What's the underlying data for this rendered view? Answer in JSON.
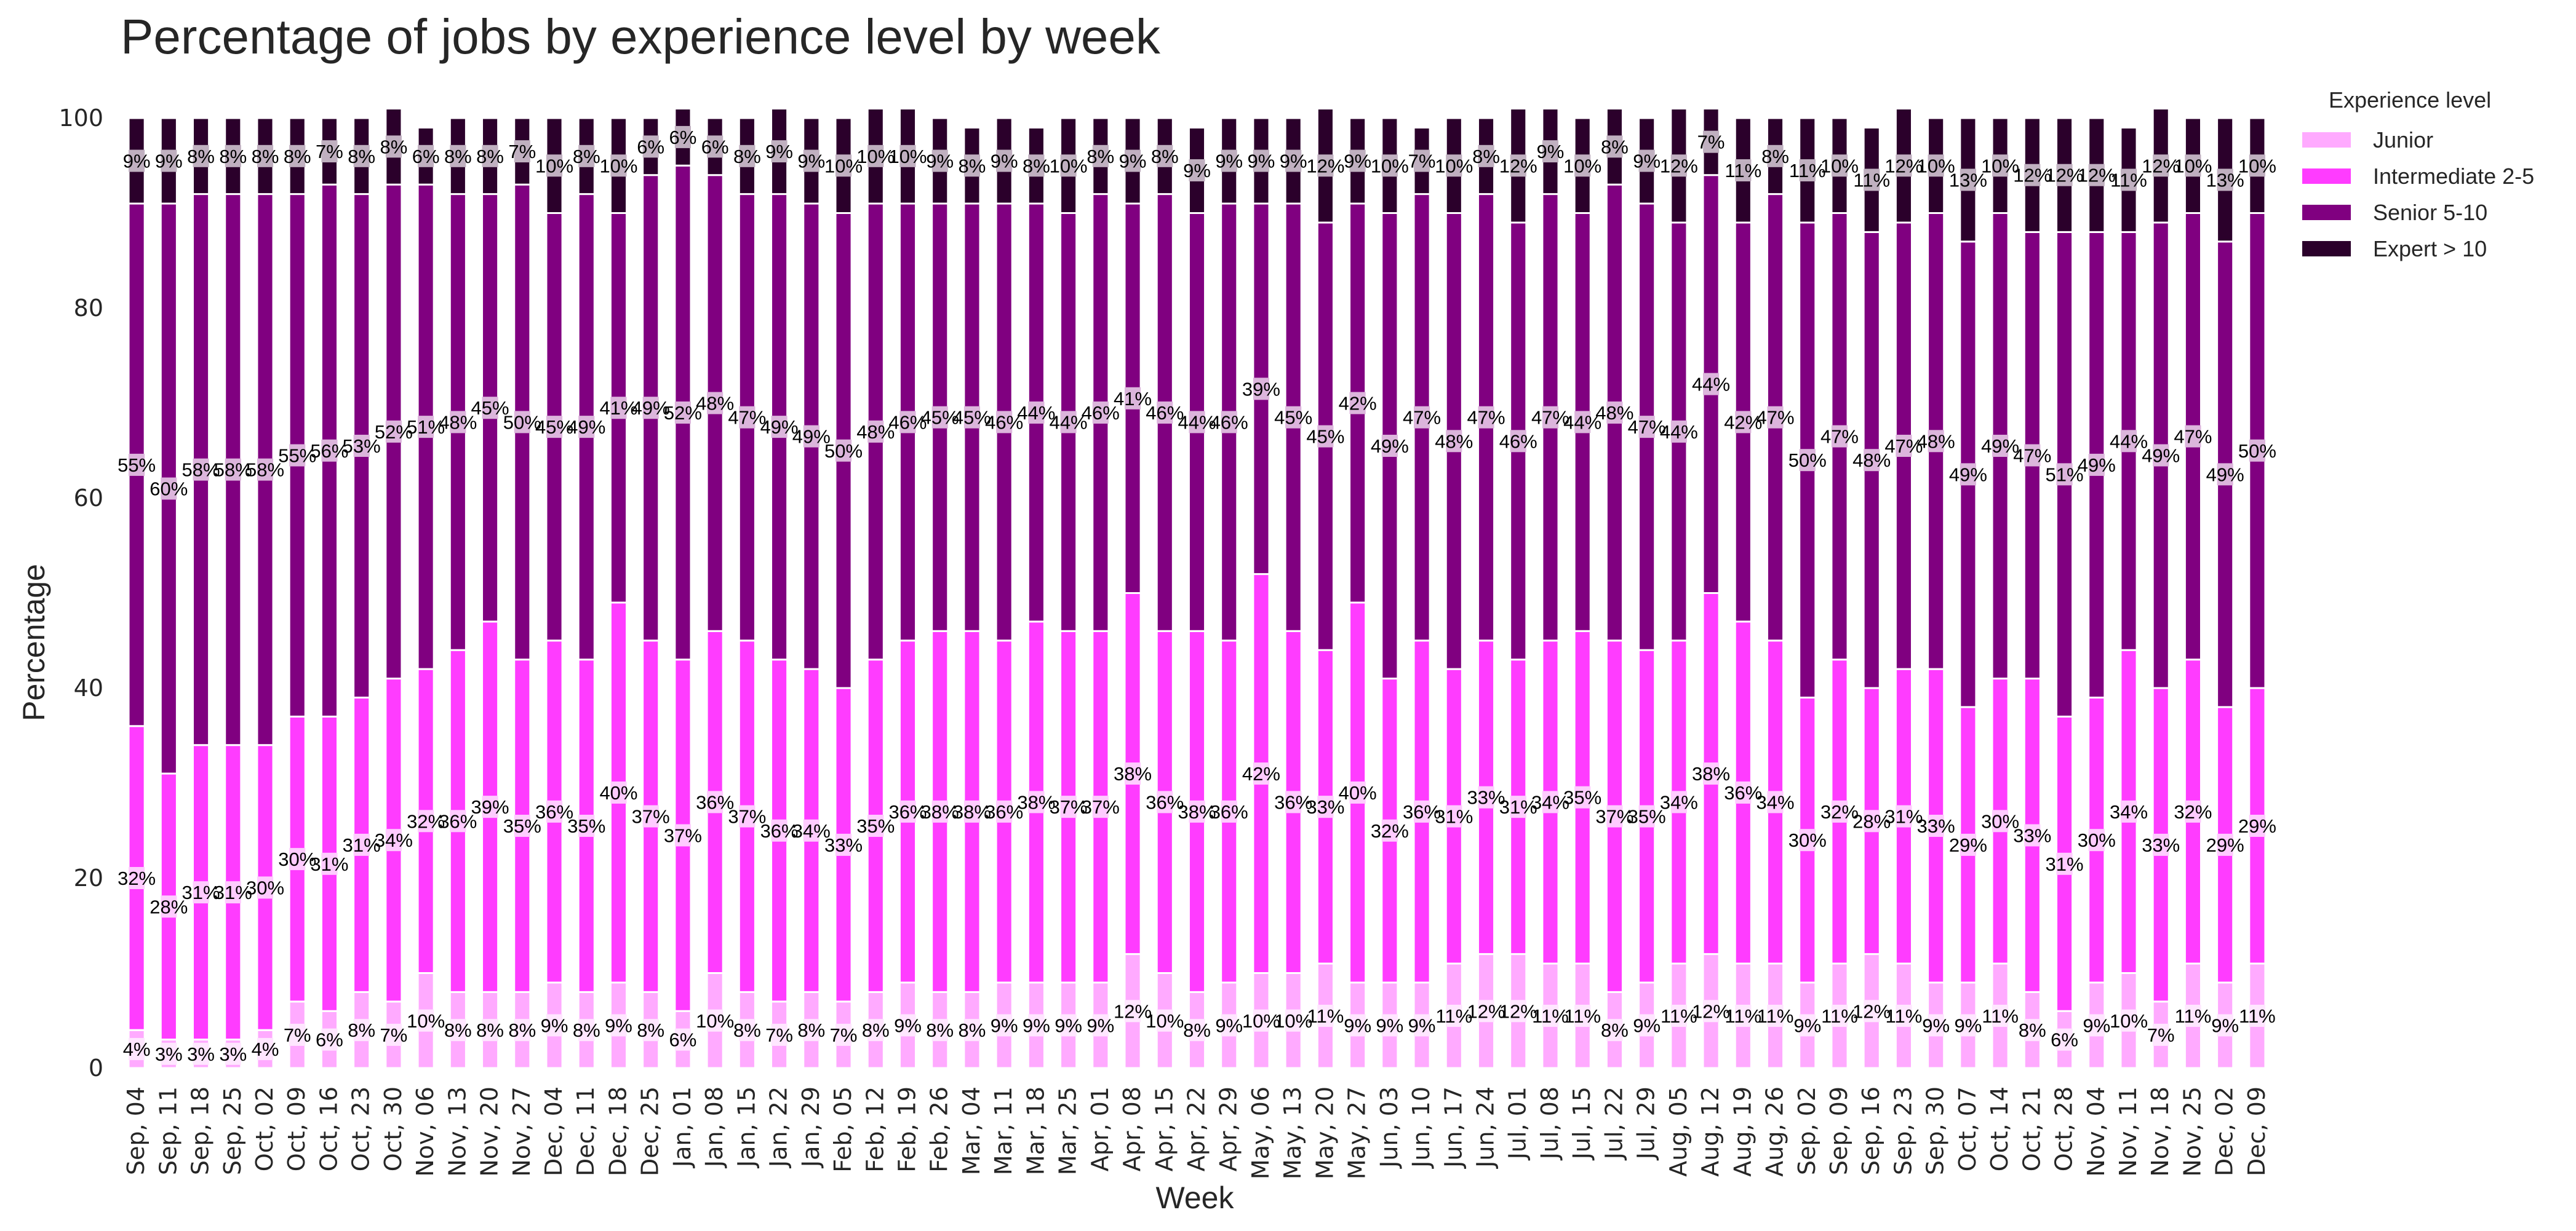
{
  "chart_data": {
    "type": "bar",
    "stacked": true,
    "title": "Percentage of jobs by experience level by week",
    "xlabel": "Week",
    "ylabel": "Percentage",
    "ylim": [
      0,
      100
    ],
    "yticks": [
      0,
      20,
      40,
      60,
      80,
      100
    ],
    "grid": false,
    "legend": {
      "title": "Experience level",
      "placement": "top-right-outside"
    },
    "categories": [
      "Sep, 04",
      "Sep, 11",
      "Sep, 18",
      "Sep, 25",
      "Oct, 02",
      "Oct, 09",
      "Oct, 16",
      "Oct, 23",
      "Oct, 30",
      "Nov, 06",
      "Nov, 13",
      "Nov, 20",
      "Nov, 27",
      "Dec, 04",
      "Dec, 11",
      "Dec, 18",
      "Dec, 25",
      "Jan, 01",
      "Jan, 08",
      "Jan, 15",
      "Jan, 22",
      "Jan, 29",
      "Feb, 05",
      "Feb, 12",
      "Feb, 19",
      "Feb, 26",
      "Mar, 04",
      "Mar, 11",
      "Mar, 18",
      "Mar, 25",
      "Apr, 01",
      "Apr, 08",
      "Apr, 15",
      "Apr, 22",
      "Apr, 29",
      "May, 06",
      "May, 13",
      "May, 20",
      "May, 27",
      "Jun, 03",
      "Jun, 10",
      "Jun, 17",
      "Jun, 24",
      "Jul, 01",
      "Jul, 08",
      "Jul, 15",
      "Jul, 22",
      "Jul, 29",
      "Aug, 05",
      "Aug, 12",
      "Aug, 19",
      "Aug, 26",
      "Sep, 02",
      "Sep, 09",
      "Sep, 16",
      "Sep, 23",
      "Sep, 30",
      "Oct, 07",
      "Oct, 14",
      "Oct, 21",
      "Oct, 28",
      "Nov, 04",
      "Nov, 11",
      "Nov, 18",
      "Nov, 25",
      "Dec, 02",
      "Dec, 09"
    ],
    "series": [
      {
        "name": "Junior",
        "color": "#ffaaff",
        "values": [
          4,
          3,
          3,
          3,
          4,
          7,
          6,
          8,
          7,
          10,
          8,
          8,
          8,
          9,
          8,
          9,
          8,
          6,
          10,
          8,
          7,
          8,
          7,
          8,
          9,
          8,
          8,
          9,
          9,
          9,
          9,
          12,
          10,
          8,
          9,
          10,
          10,
          11,
          9,
          9,
          9,
          11,
          12,
          12,
          11,
          11,
          8,
          9,
          11,
          12,
          11,
          11,
          9,
          11,
          12,
          11,
          9,
          9,
          11,
          8,
          6,
          9,
          10,
          7,
          11,
          9,
          11
        ]
      },
      {
        "name": "Intermediate 2-5",
        "color": "#ff3cff",
        "values": [
          32,
          28,
          31,
          31,
          30,
          30,
          31,
          31,
          34,
          32,
          36,
          39,
          35,
          36,
          35,
          40,
          37,
          37,
          36,
          37,
          36,
          34,
          33,
          35,
          36,
          38,
          38,
          36,
          38,
          37,
          37,
          38,
          36,
          38,
          36,
          42,
          36,
          33,
          40,
          32,
          36,
          31,
          33,
          31,
          34,
          35,
          37,
          35,
          34,
          38,
          36,
          34,
          30,
          32,
          28,
          31,
          33,
          29,
          30,
          33,
          31,
          30,
          34,
          33,
          32,
          29,
          29
        ]
      },
      {
        "name": "Senior 5-10",
        "color": "#800080",
        "values": [
          55,
          60,
          58,
          58,
          58,
          55,
          56,
          53,
          52,
          51,
          48,
          45,
          50,
          45,
          49,
          41,
          49,
          52,
          48,
          47,
          49,
          49,
          50,
          48,
          46,
          45,
          45,
          46,
          44,
          44,
          46,
          41,
          46,
          44,
          46,
          39,
          45,
          45,
          42,
          49,
          47,
          48,
          47,
          46,
          47,
          44,
          48,
          47,
          44,
          44,
          42,
          47,
          50,
          47,
          48,
          47,
          48,
          49,
          49,
          47,
          51,
          49,
          44,
          49,
          47,
          49,
          50
        ]
      },
      {
        "name": "Expert > 10",
        "color": "#2b002b",
        "values": [
          9,
          9,
          8,
          8,
          8,
          8,
          7,
          8,
          8,
          6,
          8,
          8,
          7,
          10,
          8,
          10,
          6,
          6,
          6,
          8,
          9,
          9,
          10,
          10,
          10,
          9,
          8,
          9,
          8,
          10,
          8,
          9,
          8,
          9,
          9,
          9,
          9,
          12,
          9,
          10,
          7,
          10,
          8,
          12,
          9,
          10,
          8,
          9,
          12,
          7,
          11,
          8,
          11,
          10,
          11,
          12,
          10,
          13,
          10,
          12,
          12,
          12,
          11,
          12,
          10,
          13,
          10
        ]
      }
    ],
    "label_format": "{value}%"
  }
}
